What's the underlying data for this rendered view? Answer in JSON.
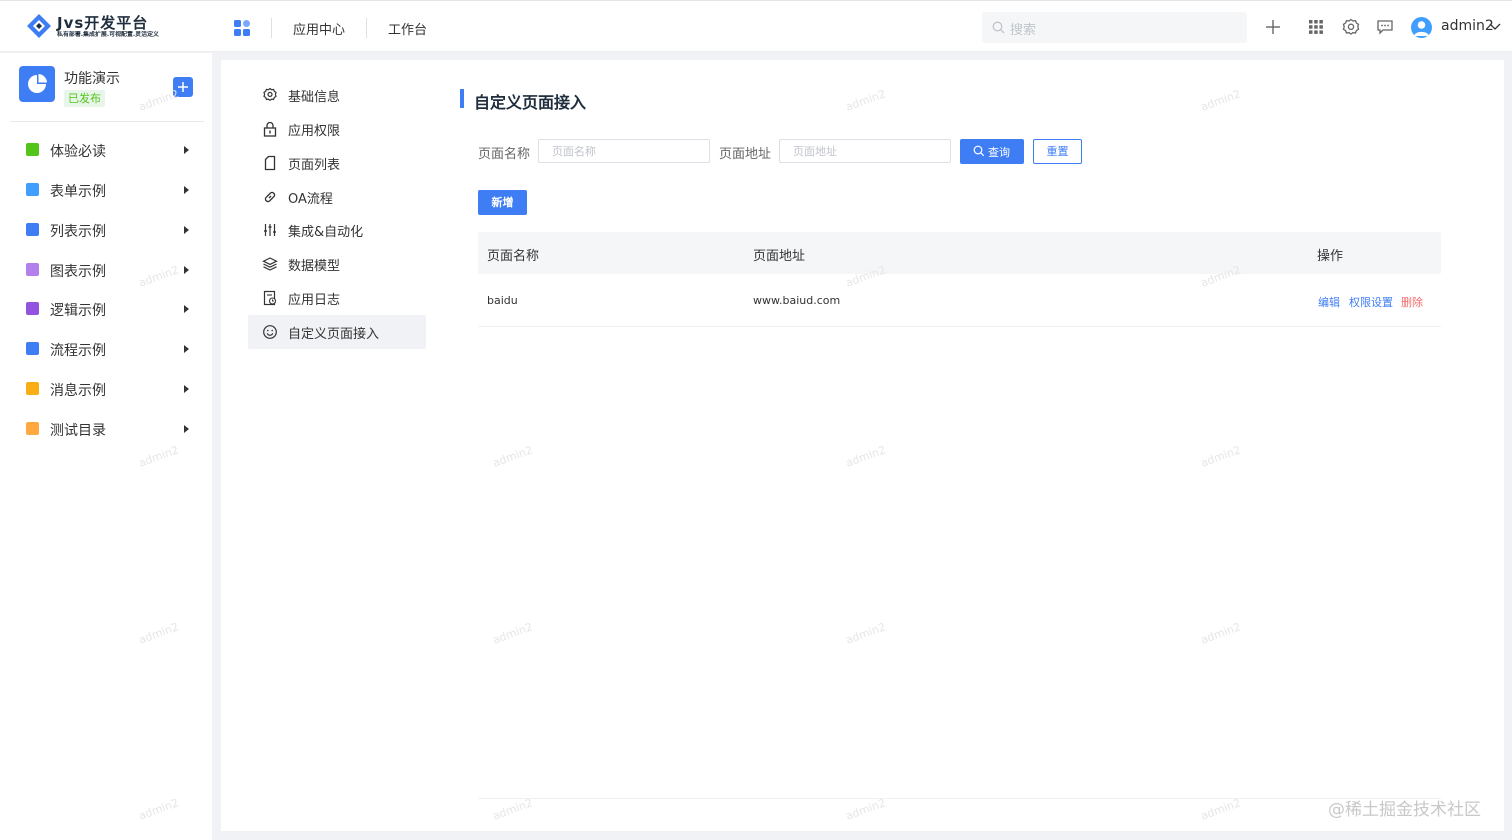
{
  "brand": {
    "title": "Jvs开发平台",
    "subtitle": "私有部署.集成扩展.可视配置.灵活定义"
  },
  "topnav": {
    "links": [
      "应用中心",
      "工作台"
    ]
  },
  "search": {
    "placeholder": "搜索"
  },
  "user": {
    "name": "admin2"
  },
  "app": {
    "name": "功能演示",
    "status": "已发布"
  },
  "sidebar": {
    "items": [
      {
        "label": "体验必读",
        "color": "#52c41a"
      },
      {
        "label": "表单示例",
        "color": "#409eff"
      },
      {
        "label": "列表示例",
        "color": "#3f7df5"
      },
      {
        "label": "图表示例",
        "color": "#b37feb"
      },
      {
        "label": "逻辑示例",
        "color": "#9254de"
      },
      {
        "label": "流程示例",
        "color": "#3f7df5"
      },
      {
        "label": "消息示例",
        "color": "#faad14"
      },
      {
        "label": "测试目录",
        "color": "#ffa940"
      }
    ]
  },
  "settings_menu": {
    "items": [
      {
        "label": "基础信息",
        "icon": "gear-icon"
      },
      {
        "label": "应用权限",
        "icon": "lock-icon"
      },
      {
        "label": "页面列表",
        "icon": "page-icon"
      },
      {
        "label": "OA流程",
        "icon": "link-icon"
      },
      {
        "label": "集成&自动化",
        "icon": "sliders-icon"
      },
      {
        "label": "数据模型",
        "icon": "layers-icon"
      },
      {
        "label": "应用日志",
        "icon": "log-icon"
      },
      {
        "label": "自定义页面接入",
        "icon": "smile-icon",
        "active": true
      }
    ]
  },
  "content": {
    "title": "自定义页面接入",
    "filters": {
      "name_label": "页面名称",
      "name_placeholder": "页面名称",
      "url_label": "页面地址",
      "url_placeholder": "页面地址"
    },
    "buttons": {
      "query": "查询",
      "reset": "重置",
      "add": "新增"
    },
    "table": {
      "columns": [
        "页面名称",
        "页面地址",
        "操作"
      ],
      "rows": [
        {
          "name": "baidu",
          "url": "www.baiud.com",
          "actions": [
            "编辑",
            "权限设置",
            "删除"
          ]
        }
      ]
    }
  },
  "watermark_text": "admin2",
  "credit": "@稀土掘金技术社区",
  "colors": {
    "primary": "#3f7df5",
    "danger": "#f56c6c",
    "success": "#52c41a"
  }
}
